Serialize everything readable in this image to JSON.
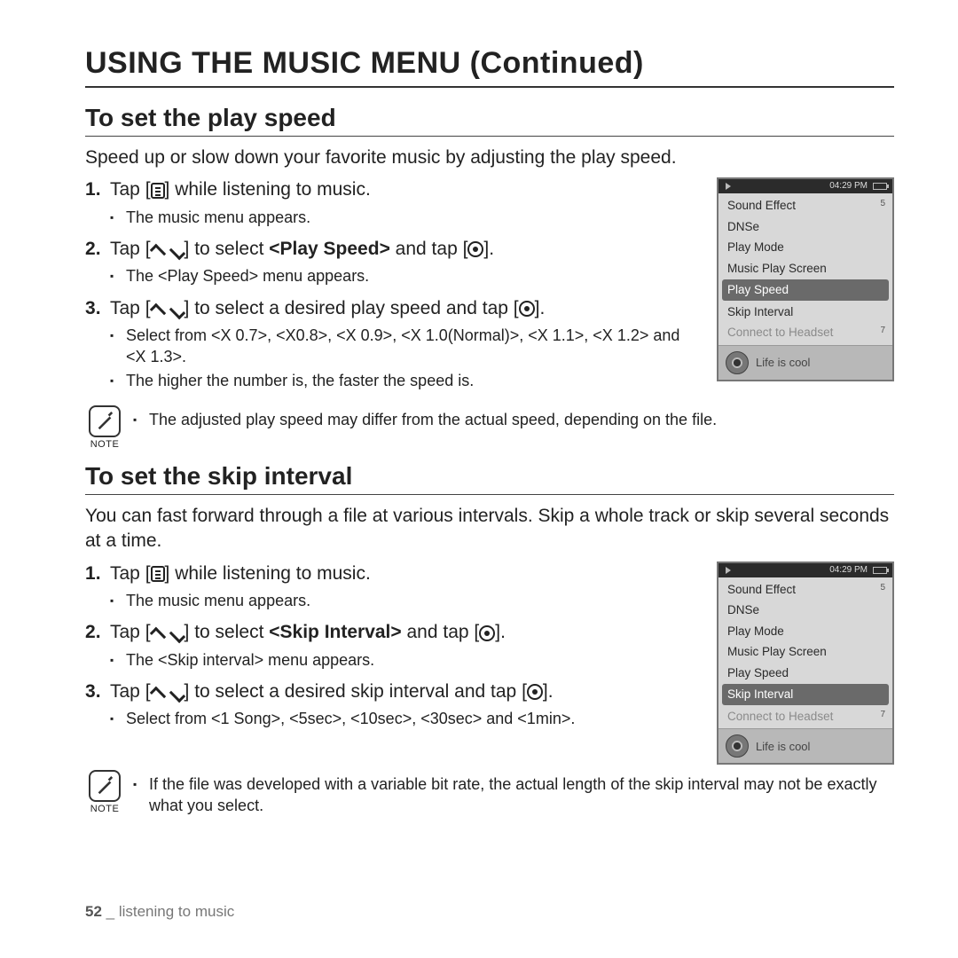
{
  "page_title": "USING THE MUSIC MENU (Continued)",
  "section1": {
    "title": "To set the play speed",
    "intro": "Speed up or slow down your favorite music by adjusting the play speed.",
    "step1a": "Tap [",
    "step1b": "] while listening to music.",
    "step1sub": "The music menu appears.",
    "step2a": "Tap [",
    "step2b": "] to select ",
    "step2bold": "<Play Speed>",
    "step2c": " and tap [",
    "step2d": "].",
    "step2sub": "The <Play Speed> menu appears.",
    "step3a": "Tap [",
    "step3b": "] to select a desired play speed and tap [",
    "step3c": "].",
    "step3sub1": "Select from <X 0.7>, <X0.8>, <X 0.9>, <X 1.0(Normal)>, <X 1.1>, <X 1.2> and <X 1.3>.",
    "step3sub2": "The higher the number is, the faster the speed is.",
    "note": "The adjusted play speed may differ from the actual speed, depending on the file."
  },
  "section2": {
    "title": "To set the skip interval",
    "intro": "You can fast forward through a file at various intervals. Skip a whole track or skip several seconds at a time.",
    "step1a": "Tap [",
    "step1b": "] while listening to music.",
    "step1sub": "The music menu appears.",
    "step2a": "Tap [",
    "step2b": "] to select ",
    "step2bold": "<Skip Interval>",
    "step2c": " and tap [",
    "step2d": "].",
    "step2sub": "The <Skip interval> menu appears.",
    "step3a": "Tap [",
    "step3b": "] to select a desired skip interval and tap [",
    "step3c": "].",
    "step3sub1": "Select from <1 Song>, <5sec>, <10sec>, <30sec> and <1min>.",
    "note": "If the file was developed with a variable bit rate, the actual length of the skip interval may not be exactly what you select."
  },
  "note_label": "NOTE",
  "device": {
    "time": "04:29 PM",
    "items": [
      "Sound Effect",
      "DNSe",
      "Play Mode",
      "Music Play Screen",
      "Play Speed",
      "Skip Interval",
      "Connect to Headset"
    ],
    "badge_top": "5",
    "badge_bottom": "7",
    "footer": "Life is cool"
  },
  "footer": {
    "page": "52",
    "sep": " _ ",
    "chapter": "listening to music"
  }
}
